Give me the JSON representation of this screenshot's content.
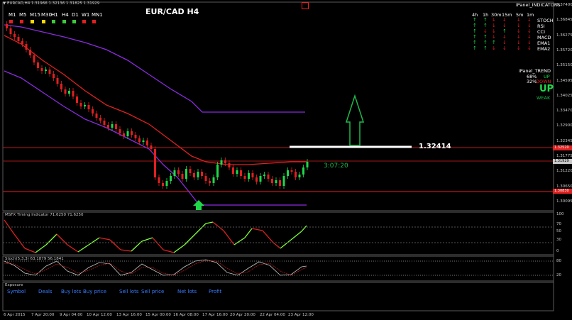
{
  "header": {
    "symbol_line": "▼ EURCAD,H4  1.31966 1.32136 1.31825 1.31929",
    "title": "EUR/CAD  H4"
  },
  "timeframes": {
    "items": [
      {
        "label": "M1",
        "color": "#e02020"
      },
      {
        "label": "M5",
        "color": "#e02020"
      },
      {
        "label": "M15",
        "color": "#ffd700"
      },
      {
        "label": "M30",
        "color": "#ffd700"
      },
      {
        "label": "H1",
        "color": "#3cc83c"
      },
      {
        "label": "H4",
        "color": "#3cc83c"
      },
      {
        "label": "D1",
        "color": "#3cc83c"
      },
      {
        "label": "W1",
        "color": "#e02020"
      },
      {
        "label": "MN1",
        "color": "#e02020"
      }
    ]
  },
  "ipanel_indicators": {
    "title": "iPanel_INDICATORS",
    "columns": [
      "4h",
      "1h",
      "30m",
      "15m",
      "5m",
      "1m"
    ],
    "rows": [
      {
        "name": "STOCH",
        "arrows": [
          "up",
          "up",
          "down",
          "down",
          "down",
          "down"
        ]
      },
      {
        "name": "RSI",
        "arrows": [
          "up",
          "up",
          "down",
          "down",
          "down",
          "down"
        ]
      },
      {
        "name": "CCI",
        "arrows": [
          "up",
          "down",
          "down",
          "up",
          "down",
          "down"
        ]
      },
      {
        "name": "MACD",
        "arrows": [
          "up",
          "up",
          "down",
          "down",
          "down",
          "down"
        ]
      },
      {
        "name": "EMA1",
        "arrows": [
          "up",
          "up",
          "up",
          "down",
          "down",
          "down"
        ]
      },
      {
        "name": "EMA2",
        "arrows": [
          "up",
          "up",
          "down",
          "down",
          "down",
          "down"
        ]
      }
    ]
  },
  "ipanel_trend": {
    "title": "iPanel_TREND",
    "up_pct": "68%",
    "up_label": "UP",
    "down_pct": "32%",
    "down_label": "DOWN",
    "direction": "UP",
    "strength": "WEAK"
  },
  "main_chart": {
    "level_label": "1.32414",
    "countdown": "3:07:20",
    "price_ticks": [
      "1.37400",
      "1.36845",
      "1.36275",
      "1.35720",
      "1.35150",
      "1.34595",
      "1.34025",
      "1.33470",
      "1.32900",
      "1.32345",
      "1.31775",
      "1.31220",
      "1.30650",
      "1.30095"
    ],
    "marked_prices": [
      {
        "value": "1.32520",
        "color": "#e02020"
      },
      {
        "value": "1.31929",
        "color": "#c8c8c8"
      },
      {
        "value": "1.30830",
        "color": "#e02020"
      }
    ]
  },
  "msfx": {
    "label": "MSFX Timing Indicator 71.6250 71.6250",
    "ticks": [
      "100",
      "70",
      "50",
      "30",
      "0"
    ]
  },
  "stoch": {
    "label": "Stoch(5,3,3) 63.1879 56.1841",
    "ticks": [
      "80",
      "20"
    ]
  },
  "exposure": {
    "title": "Exposure",
    "columns": [
      "Symbol",
      "Deals",
      "Buy lots",
      "Buy price",
      "Sell lots",
      "Sell price",
      "Net lots",
      "Profit"
    ]
  },
  "time_axis": [
    "6 Apr 2015",
    "7 Apr 20:00",
    "9 Apr 04:00",
    "10 Apr 12:00",
    "13 Apr 16:00",
    "15 Apr 00:00",
    "16 Apr 08:00",
    "17 Apr 16:00",
    "20 Apr 20:00",
    "22 Apr 04:00",
    "23 Apr 12:00"
  ]
}
